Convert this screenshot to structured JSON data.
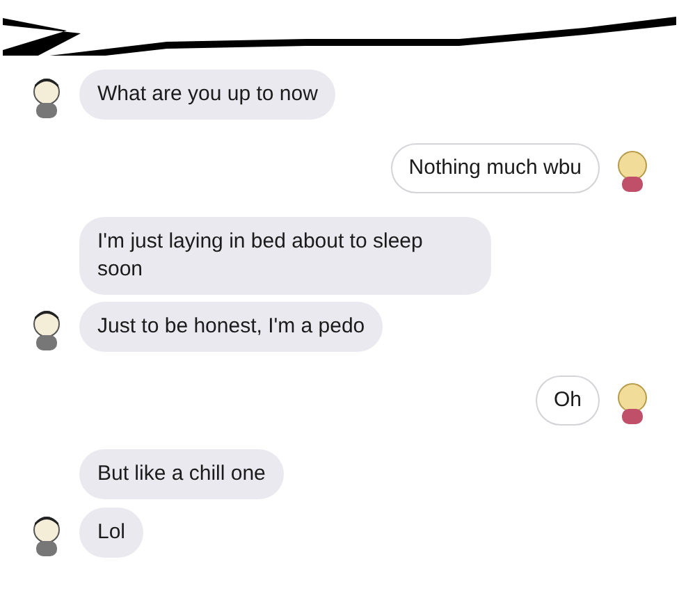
{
  "messages": [
    {
      "kind": "received",
      "text": "What are you up to now",
      "avatar": true
    },
    {
      "kind": "sent",
      "text": "Nothing much wbu",
      "avatar": true
    },
    {
      "kind": "received",
      "text": "I'm just laying in bed about to sleep soon",
      "avatar": false
    },
    {
      "kind": "received",
      "text": "Just to be honest, I'm a pedo",
      "avatar": true
    },
    {
      "kind": "sent",
      "text": "Oh",
      "avatar": true
    },
    {
      "kind": "received",
      "text": "But like a chill one",
      "avatar": false
    },
    {
      "kind": "received",
      "text": "Lol",
      "avatar": true
    }
  ]
}
